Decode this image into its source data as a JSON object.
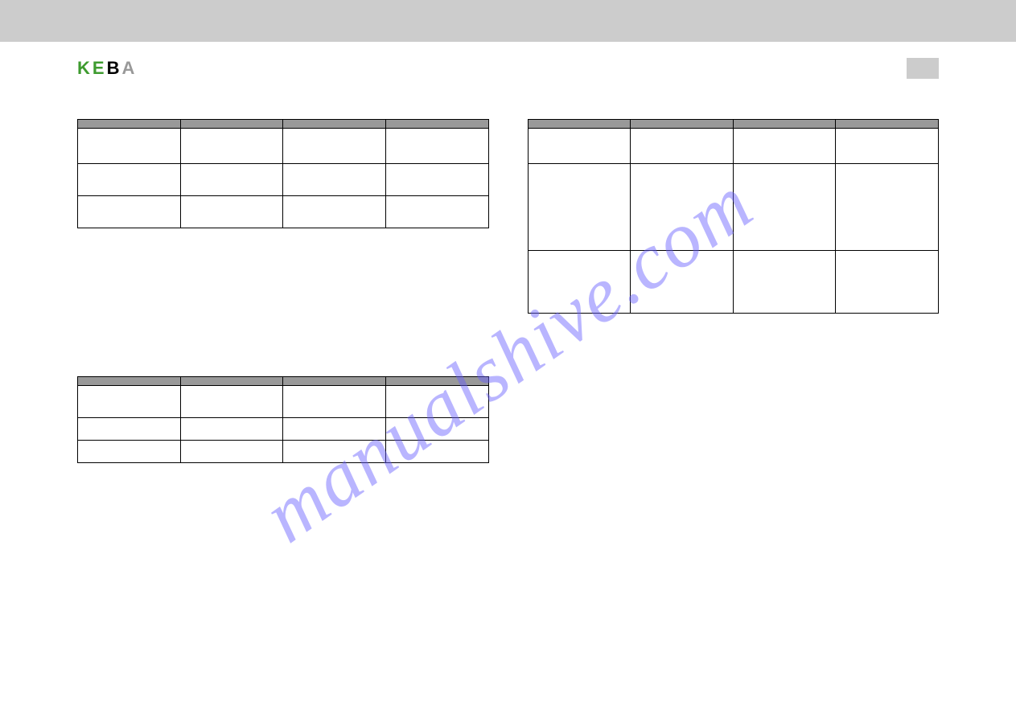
{
  "logo": {
    "text_k": "K",
    "text_e": "E",
    "text_b": "B",
    "text_a": "A"
  },
  "header_right": "",
  "watermark": "manualshive.com",
  "section_a_title": " ",
  "section_b_title": " ",
  "section_c_title": " ",
  "table_a": {
    "headers": [
      "",
      "",
      "",
      ""
    ],
    "rows": [
      [
        "",
        "",
        "",
        ""
      ],
      [
        "",
        "",
        "",
        ""
      ],
      [
        "",
        "",
        "",
        ""
      ]
    ]
  },
  "table_b": {
    "headers": [
      "",
      "",
      "",
      ""
    ],
    "rows": [
      [
        "",
        "",
        "",
        ""
      ],
      [
        "",
        "",
        "",
        ""
      ],
      [
        "",
        "",
        "",
        ""
      ]
    ]
  },
  "table_c": {
    "headers": [
      "",
      "",
      "",
      ""
    ],
    "rows": [
      [
        "",
        "",
        "",
        ""
      ],
      [
        "",
        "",
        "",
        ""
      ],
      [
        "",
        "",
        "",
        ""
      ]
    ]
  },
  "footer": {
    "left": "",
    "center": "",
    "right": ""
  }
}
